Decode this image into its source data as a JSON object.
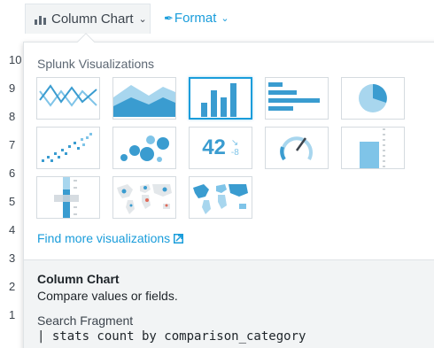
{
  "toolbar": {
    "viz_label": "Column Chart",
    "format_label": "Format"
  },
  "background_axis": [
    "10",
    "9",
    "8",
    "7",
    "6",
    "5",
    "4",
    "3",
    "2",
    "1"
  ],
  "panel": {
    "title": "Splunk Visualizations",
    "find_more": "Find more visualizations",
    "tiles": [
      {
        "name": "line-chart",
        "selected": false
      },
      {
        "name": "area-chart",
        "selected": false
      },
      {
        "name": "column-chart",
        "selected": true
      },
      {
        "name": "bar-chart",
        "selected": false
      },
      {
        "name": "pie-chart",
        "selected": false
      },
      {
        "name": "scatter-chart",
        "selected": false
      },
      {
        "name": "bubble-chart",
        "selected": false
      },
      {
        "name": "single-value",
        "selected": false,
        "value": "42",
        "delta": "-8"
      },
      {
        "name": "radial-gauge",
        "selected": false
      },
      {
        "name": "filler-gauge",
        "selected": false
      },
      {
        "name": "marker-gauge",
        "selected": false
      },
      {
        "name": "cluster-map",
        "selected": false
      },
      {
        "name": "choropleth-map",
        "selected": false
      }
    ],
    "info": {
      "title": "Column Chart",
      "description": "Compare values or fields.",
      "fragment_label": "Search Fragment",
      "fragment": "| stats count by comparison_category"
    }
  },
  "colors": {
    "accent": "#1a9ddb",
    "tile_dark": "#3a9cd0",
    "tile_light": "#a8d6ee"
  }
}
